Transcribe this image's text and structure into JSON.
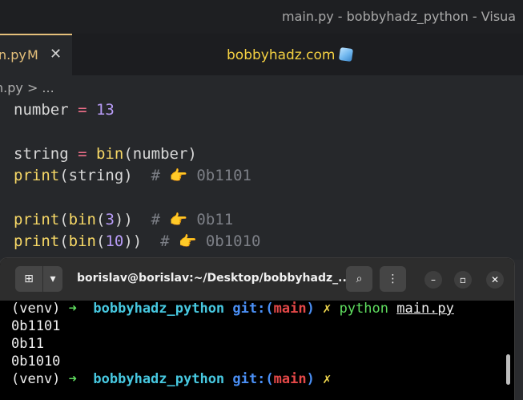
{
  "window": {
    "title": "main.py - bobbyhadz_python - Visua"
  },
  "tab": {
    "filename": "n.py",
    "modified": "M",
    "close": "✕"
  },
  "brand": {
    "text": "bobbyhadz.com"
  },
  "breadcrumb": "n.py > ...",
  "code": [
    {
      "text": "number = 13"
    },
    {
      "text": ""
    },
    {
      "text": "string = bin(number)"
    },
    {
      "text": "print(string)  # 👉 0b1101"
    },
    {
      "text": ""
    },
    {
      "text": "print(bin(3))  # 👉 0b11"
    },
    {
      "text": "print(bin(10))  # 👉 0b1010"
    }
  ],
  "terminal": {
    "title": "borislav@borislav:~/Desktop/bobbyhadz_...",
    "prompt_venv": "(venv)",
    "project": "bobbyhadz_python",
    "git_label": "git:(",
    "branch": "main",
    "git_close": ")",
    "dirty_mark": "✗",
    "command": "python",
    "argument": "main.py",
    "output": [
      "0b1101",
      "0b11",
      "0b1010"
    ]
  },
  "colors": {
    "brand": "#f5d142",
    "tab_accent": "#e5c07b",
    "function": "#f7d866",
    "operator": "#f06f8a",
    "number": "#b89cf7",
    "comment": "#7c7f86"
  }
}
